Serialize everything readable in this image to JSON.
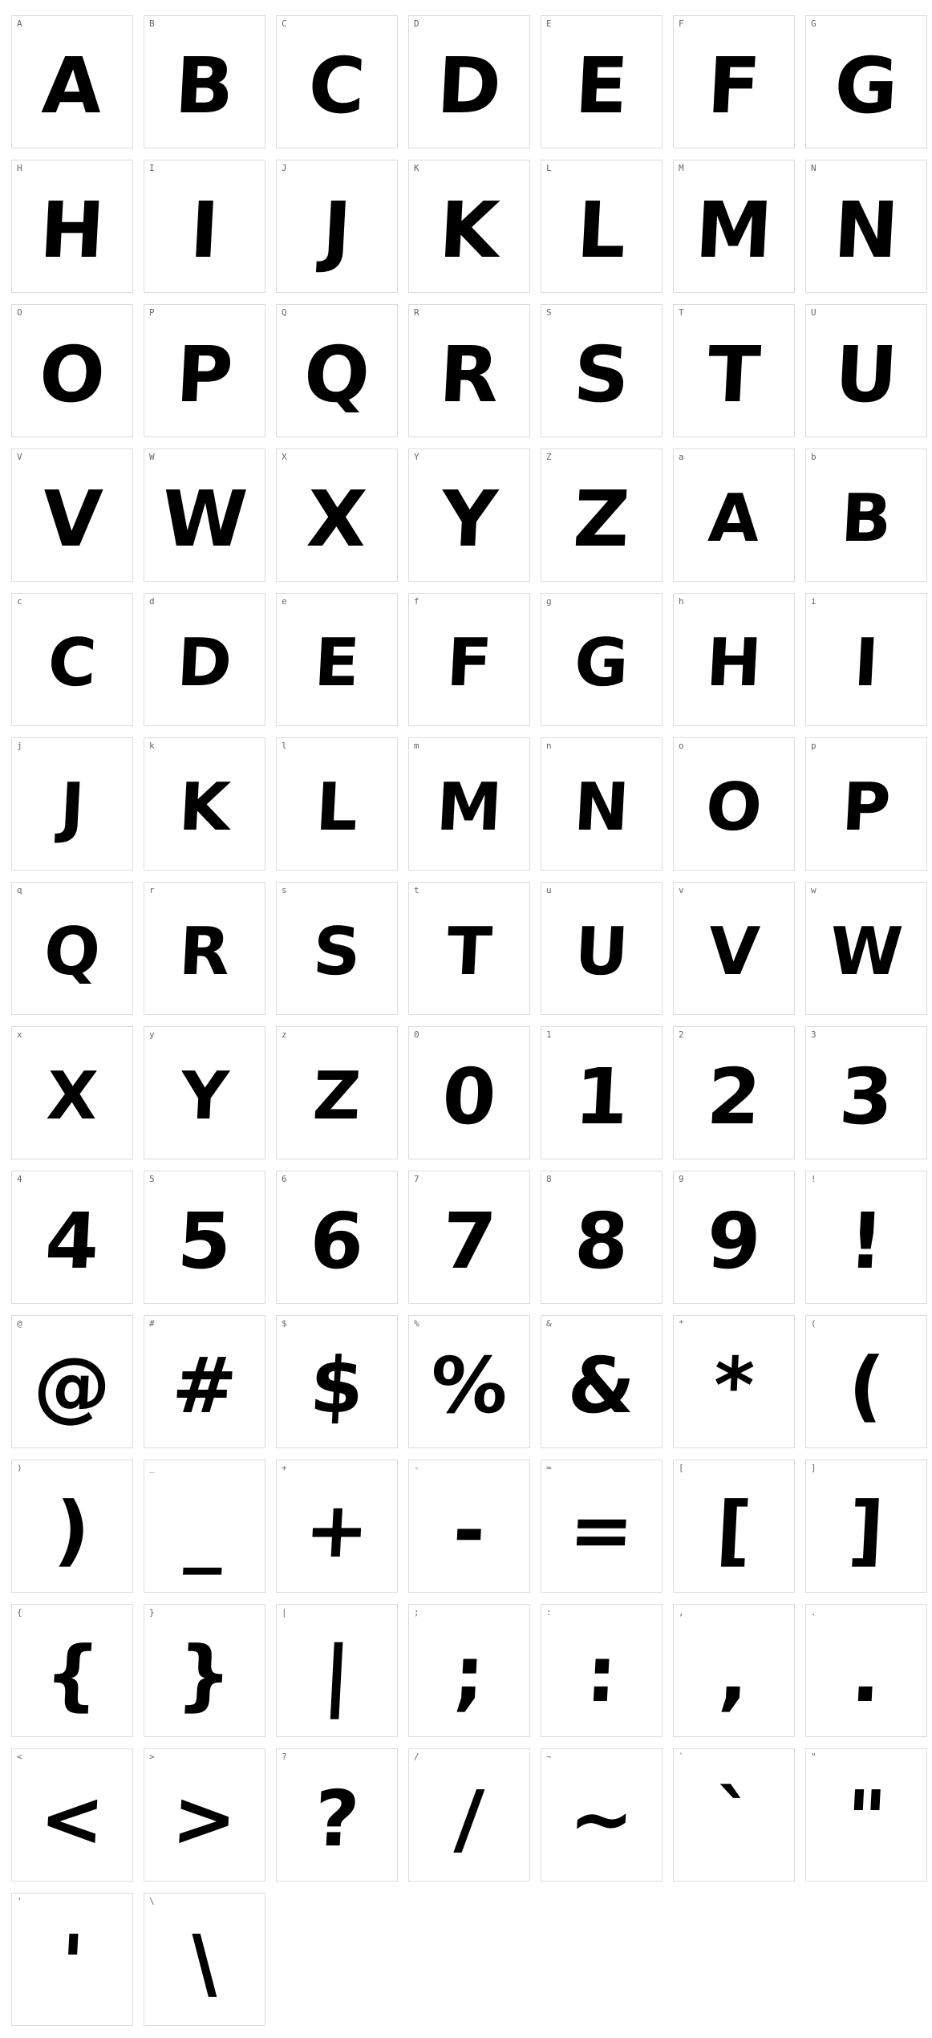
{
  "glyph_map": {
    "title": "",
    "glyphs": [
      {
        "label": "A",
        "char": "A"
      },
      {
        "label": "B",
        "char": "B"
      },
      {
        "label": "C",
        "char": "C"
      },
      {
        "label": "D",
        "char": "D"
      },
      {
        "label": "E",
        "char": "E"
      },
      {
        "label": "F",
        "char": "F"
      },
      {
        "label": "G",
        "char": "G"
      },
      {
        "label": "H",
        "char": "H"
      },
      {
        "label": "I",
        "char": "I"
      },
      {
        "label": "J",
        "char": "J"
      },
      {
        "label": "K",
        "char": "K"
      },
      {
        "label": "L",
        "char": "L"
      },
      {
        "label": "M",
        "char": "M"
      },
      {
        "label": "N",
        "char": "N"
      },
      {
        "label": "O",
        "char": "O"
      },
      {
        "label": "P",
        "char": "P"
      },
      {
        "label": "Q",
        "char": "Q"
      },
      {
        "label": "R",
        "char": "R"
      },
      {
        "label": "S",
        "char": "S"
      },
      {
        "label": "T",
        "char": "T"
      },
      {
        "label": "U",
        "char": "U"
      },
      {
        "label": "V",
        "char": "V"
      },
      {
        "label": "W",
        "char": "W"
      },
      {
        "label": "X",
        "char": "X"
      },
      {
        "label": "Y",
        "char": "Y"
      },
      {
        "label": "Z",
        "char": "Z"
      },
      {
        "label": "a",
        "char": "A"
      },
      {
        "label": "b",
        "char": "B"
      },
      {
        "label": "c",
        "char": "C"
      },
      {
        "label": "d",
        "char": "D"
      },
      {
        "label": "e",
        "char": "E"
      },
      {
        "label": "f",
        "char": "F"
      },
      {
        "label": "g",
        "char": "G"
      },
      {
        "label": "h",
        "char": "H"
      },
      {
        "label": "i",
        "char": "I"
      },
      {
        "label": "j",
        "char": "J"
      },
      {
        "label": "k",
        "char": "K"
      },
      {
        "label": "l",
        "char": "L"
      },
      {
        "label": "m",
        "char": "M"
      },
      {
        "label": "n",
        "char": "N"
      },
      {
        "label": "o",
        "char": "O"
      },
      {
        "label": "p",
        "char": "P"
      },
      {
        "label": "q",
        "char": "Q"
      },
      {
        "label": "r",
        "char": "R"
      },
      {
        "label": "s",
        "char": "S"
      },
      {
        "label": "t",
        "char": "T"
      },
      {
        "label": "u",
        "char": "U"
      },
      {
        "label": "v",
        "char": "V"
      },
      {
        "label": "w",
        "char": "W"
      },
      {
        "label": "x",
        "char": "X"
      },
      {
        "label": "y",
        "char": "Y"
      },
      {
        "label": "z",
        "char": "Z"
      },
      {
        "label": "0",
        "char": "0"
      },
      {
        "label": "1",
        "char": "1"
      },
      {
        "label": "2",
        "char": "2"
      },
      {
        "label": "3",
        "char": "3"
      },
      {
        "label": "4",
        "char": "4"
      },
      {
        "label": "5",
        "char": "5"
      },
      {
        "label": "6",
        "char": "6"
      },
      {
        "label": "7",
        "char": "7"
      },
      {
        "label": "8",
        "char": "8"
      },
      {
        "label": "9",
        "char": "9"
      },
      {
        "label": "!",
        "char": "!"
      },
      {
        "label": "@",
        "char": "@"
      },
      {
        "label": "#",
        "char": "#"
      },
      {
        "label": "$",
        "char": "$"
      },
      {
        "label": "%",
        "char": "%"
      },
      {
        "label": "&",
        "char": "&"
      },
      {
        "label": "*",
        "char": "*"
      },
      {
        "label": "(",
        "char": "("
      },
      {
        "label": ")",
        "char": ")"
      },
      {
        "label": "_",
        "char": "_"
      },
      {
        "label": "+",
        "char": "+"
      },
      {
        "label": "-",
        "char": "-"
      },
      {
        "label": "=",
        "char": "="
      },
      {
        "label": "[",
        "char": "["
      },
      {
        "label": "]",
        "char": "]"
      },
      {
        "label": "{",
        "char": "{"
      },
      {
        "label": "}",
        "char": "}"
      },
      {
        "label": "|",
        "char": "|"
      },
      {
        "label": ";",
        "char": ";"
      },
      {
        "label": ":",
        "char": ":"
      },
      {
        "label": ",",
        "char": ","
      },
      {
        "label": ".",
        "char": "."
      },
      {
        "label": "<",
        "char": "<"
      },
      {
        "label": ">",
        "char": ">"
      },
      {
        "label": "?",
        "char": "?"
      },
      {
        "label": "/",
        "char": "/"
      },
      {
        "label": "~",
        "char": "~"
      },
      {
        "label": "`",
        "char": "`"
      },
      {
        "label": "\"",
        "char": "\""
      },
      {
        "label": "'",
        "char": "'"
      },
      {
        "label": "\\",
        "char": "\\"
      }
    ]
  },
  "colors": {
    "background": "#ffffff",
    "cell_border": "#dcdcdc",
    "label": "#666666",
    "glyph": "#000000"
  }
}
